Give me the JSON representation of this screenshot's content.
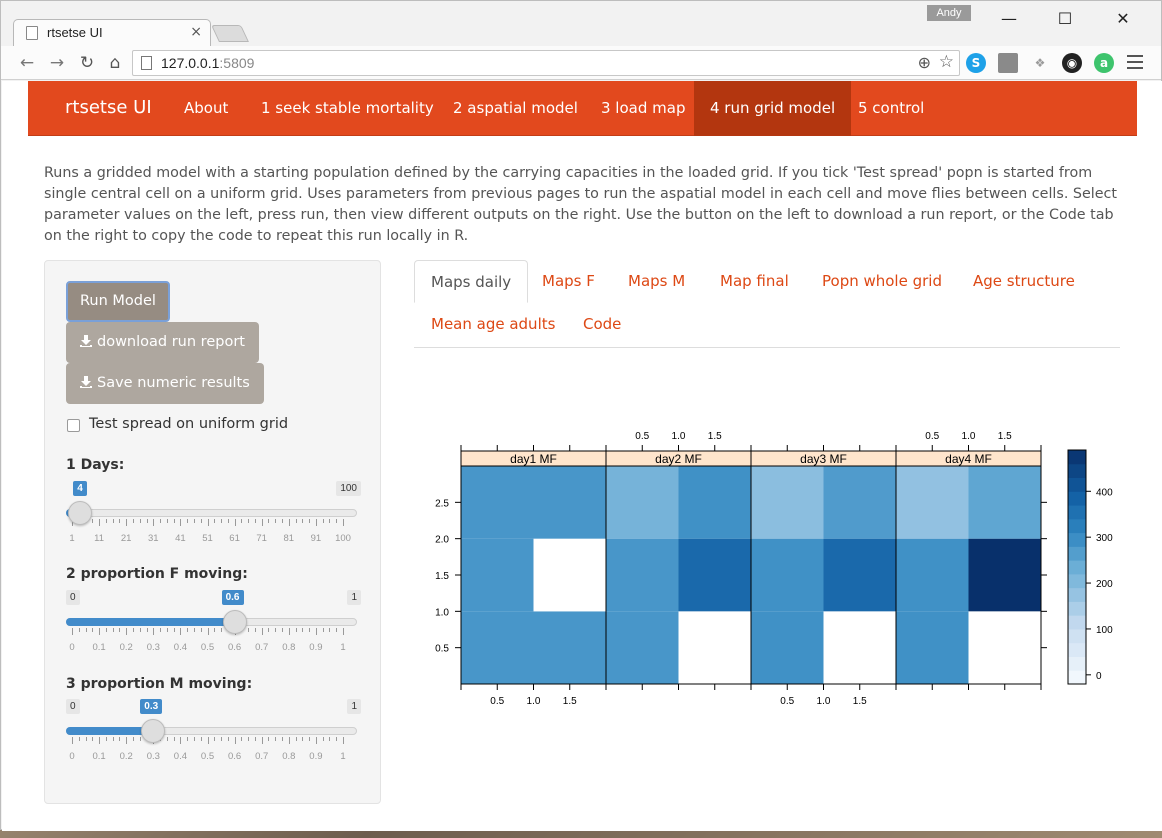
{
  "browser": {
    "tab_title": "rtsetse UI",
    "tab_close": "×",
    "profile": "Andy",
    "url_host": "127.0.0.1",
    "url_port": ":5809",
    "window_minimize": "—",
    "window_maximize": "☐",
    "window_close": "✕"
  },
  "navbar": {
    "brand": "rtsetse UI",
    "items": [
      {
        "label": "About",
        "active": false
      },
      {
        "label": "1 seek stable mortality",
        "active": false
      },
      {
        "label": "2 aspatial model",
        "active": false
      },
      {
        "label": "3 load map",
        "active": false
      },
      {
        "label": "4 run grid model",
        "active": true
      },
      {
        "label": "5 control",
        "active": false
      }
    ]
  },
  "intro_text": "Runs a gridded model with a starting population defined by the carrying capacities in the loaded grid. If you tick 'Test spread' popn is started from single central cell on a uniform grid. Uses parameters from previous pages to run the aspatial model in each cell and move flies between cells. Select parameter values on the left, press run, then view different outputs on the right. Use the button on the left to download a run report, or the Code tab on the right to copy the code to repeat this run locally in R.",
  "sidebar": {
    "run_button": "Run Model",
    "download_button": "download run report",
    "save_button": "Save numeric results",
    "test_spread_label": "Test spread on uniform grid",
    "test_spread_checked": false,
    "sliders": [
      {
        "label": "1 Days:",
        "min": "1",
        "max": "100",
        "value": "4",
        "fraction": 0.0303,
        "tick_labels": [
          "1",
          "11",
          "21",
          "31",
          "41",
          "51",
          "61",
          "71",
          "81",
          "91",
          "100"
        ]
      },
      {
        "label": "2 proportion F moving:",
        "min": "0",
        "max": "1",
        "value": "0.6",
        "fraction": 0.6,
        "tick_labels": [
          "0",
          "0.1",
          "0.2",
          "0.3",
          "0.4",
          "0.5",
          "0.6",
          "0.7",
          "0.8",
          "0.9",
          "1"
        ]
      },
      {
        "label": "3 proportion M moving:",
        "min": "0",
        "max": "1",
        "value": "0.3",
        "fraction": 0.3,
        "tick_labels": [
          "0",
          "0.1",
          "0.2",
          "0.3",
          "0.4",
          "0.5",
          "0.6",
          "0.7",
          "0.8",
          "0.9",
          "1"
        ]
      }
    ]
  },
  "tabs": [
    {
      "label": "Maps daily",
      "active": true
    },
    {
      "label": "Maps F",
      "active": false
    },
    {
      "label": "Maps M",
      "active": false
    },
    {
      "label": "Map final",
      "active": false
    },
    {
      "label": "Popn whole grid",
      "active": false
    },
    {
      "label": "Age structure",
      "active": false
    },
    {
      "label": "Mean age adults",
      "active": false
    },
    {
      "label": "Code",
      "active": false
    }
  ],
  "chart_data": {
    "type": "heatmap",
    "panels": [
      {
        "label": "day1 MF",
        "cells": [
          [
            280,
            280
          ],
          [
            280,
            null
          ],
          [
            280,
            280
          ]
        ]
      },
      {
        "label": "day2 MF",
        "cells": [
          [
            280,
            null
          ],
          [
            280,
            370
          ],
          [
            220,
            290
          ]
        ]
      },
      {
        "label": "day3 MF",
        "cells": [
          [
            290,
            null
          ],
          [
            290,
            370
          ],
          [
            190,
            270
          ]
        ]
      },
      {
        "label": "day4 MF",
        "cells": [
          [
            290,
            null
          ],
          [
            290,
            490
          ],
          [
            180,
            250
          ]
        ]
      }
    ],
    "cells_note": "rows listed bottom-to-top: y 0-1, 1-2, 2-3; columns x 0-1, 1-2; null = empty (white)",
    "x_ticks": [
      "0.5",
      "1.0",
      "1.5"
    ],
    "y_ticks": [
      "0.5",
      "1.0",
      "1.5",
      "2.0",
      "2.5"
    ],
    "xlim": [
      0,
      2
    ],
    "ylim": [
      0,
      3
    ],
    "colorbar": {
      "min": -20,
      "max": 490,
      "ticks": [
        "0",
        "100",
        "200",
        "300",
        "400"
      ]
    },
    "colors": {
      "low": "#f7fbff",
      "high": "#08306b",
      "strip_bg": "#ffe5cc"
    }
  }
}
